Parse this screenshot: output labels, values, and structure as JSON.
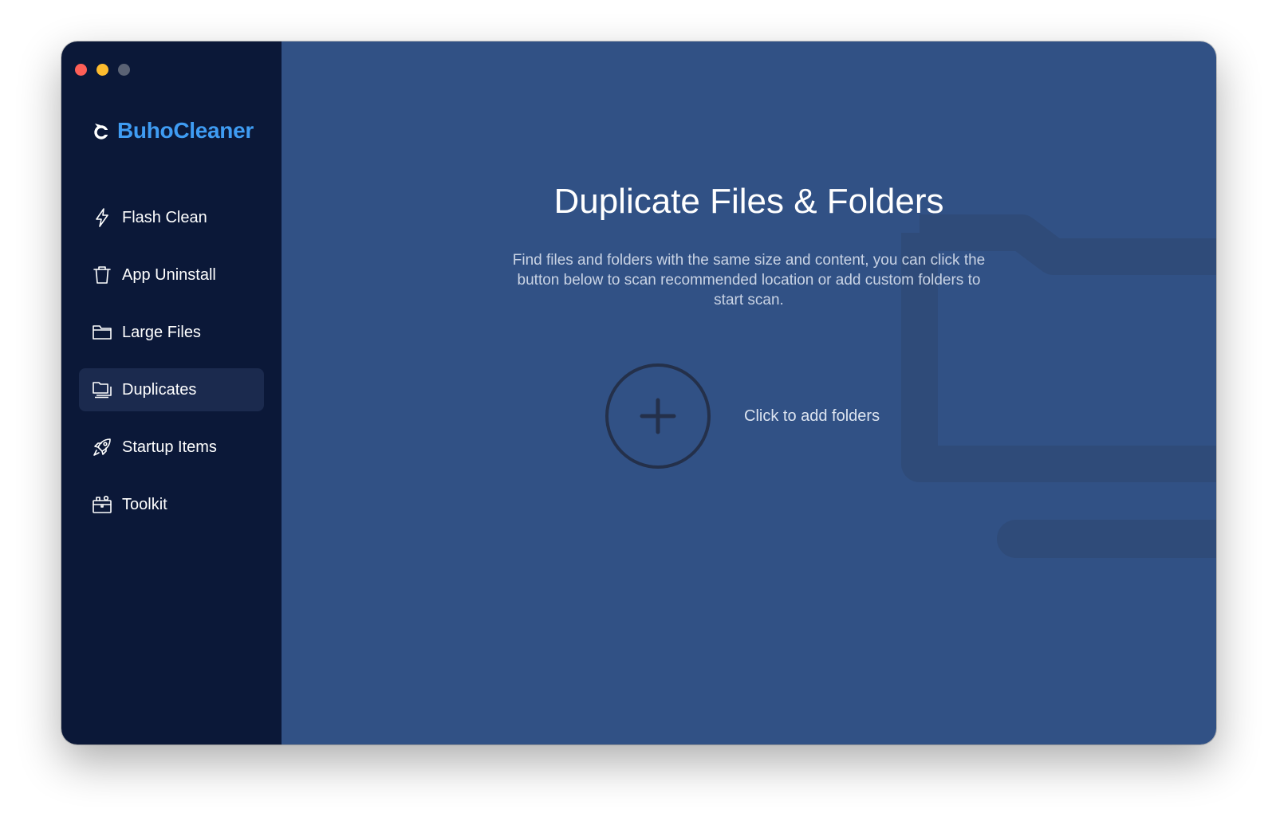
{
  "app": {
    "name": "BuhoCleaner",
    "brand_color": "#3f9cf3",
    "logo_icon": "buho-logo-icon"
  },
  "window_controls": [
    "close",
    "minimize",
    "zoom"
  ],
  "sidebar": {
    "items": [
      {
        "label": "Flash Clean",
        "icon": "lightning-icon",
        "active": false
      },
      {
        "label": "App Uninstall",
        "icon": "trash-icon",
        "active": false
      },
      {
        "label": "Large Files",
        "icon": "folder-icon",
        "active": false
      },
      {
        "label": "Duplicates",
        "icon": "duplicate-folders-icon",
        "active": true
      },
      {
        "label": "Startup Items",
        "icon": "rocket-icon",
        "active": false
      },
      {
        "label": "Toolkit",
        "icon": "toolkit-icon",
        "active": false
      }
    ]
  },
  "main": {
    "title": "Duplicate Files & Folders",
    "description": "Find files and folders with the same size and content, you can click the button below to scan recommended location or add custom folders to start scan.",
    "add_button_label": "Click to add folders",
    "add_icon": "plus-circle-icon"
  },
  "colors": {
    "sidebar_bg": "#0b1838",
    "main_bg": "#315185",
    "active_item_bg": "#1b2a4e"
  }
}
